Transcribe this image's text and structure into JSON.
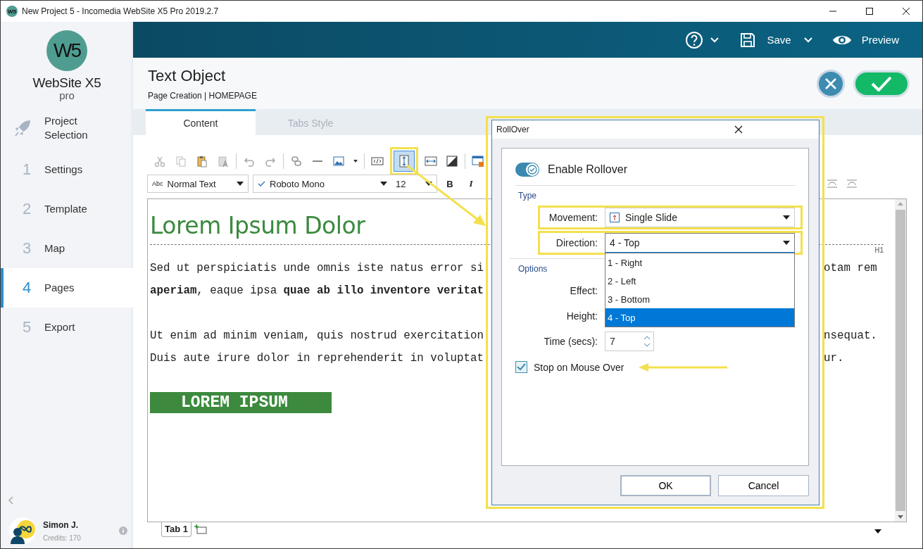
{
  "window": {
    "app_icon": "W5",
    "title": "New Project 5 - Incomedia WebSite X5 Pro 2019.2.7"
  },
  "sidebar": {
    "logo": {
      "mark": "W5",
      "name": "WebSite X5",
      "edition": "pro"
    },
    "items": [
      {
        "kind": "icon",
        "label": "Project Selection",
        "selected": false
      },
      {
        "kind": "numbered",
        "number": "1",
        "label": "Settings",
        "selected": false
      },
      {
        "kind": "numbered",
        "number": "2",
        "label": "Template",
        "selected": false
      },
      {
        "kind": "numbered",
        "number": "3",
        "label": "Map",
        "selected": false
      },
      {
        "kind": "numbered",
        "number": "4",
        "label": "Pages",
        "selected": true
      },
      {
        "kind": "numbered",
        "number": "5",
        "label": "Export",
        "selected": false
      }
    ],
    "user": {
      "name": "Simon J.",
      "credits": "Credits: 170"
    }
  },
  "topbar": {
    "save": "Save",
    "preview": "Preview"
  },
  "header": {
    "title": "Text Object",
    "breadcrumb": "Page Creation | HOMEPAGE"
  },
  "tabs": [
    {
      "label": "Content",
      "selected": true
    },
    {
      "label": "Tabs Style",
      "selected": false
    }
  ],
  "toolbar": [
    {
      "kind": "cut",
      "selected": false,
      "annotated": false
    },
    {
      "kind": "copy",
      "selected": false,
      "annotated": false
    },
    {
      "kind": "paste",
      "selected": false,
      "annotated": false
    },
    {
      "kind": "paste-text",
      "selected": false,
      "annotated": false
    },
    {
      "kind": "separator"
    },
    {
      "kind": "undo",
      "selected": false,
      "annotated": false
    },
    {
      "kind": "redo",
      "selected": false,
      "annotated": false
    },
    {
      "kind": "separator"
    },
    {
      "kind": "link",
      "selected": false,
      "annotated": false
    },
    {
      "kind": "rule",
      "selected": false,
      "annotated": false
    },
    {
      "kind": "image",
      "selected": false,
      "annotated": false
    },
    {
      "kind": "caret",
      "selected": false,
      "annotated": false
    },
    {
      "kind": "separator"
    },
    {
      "kind": "html",
      "selected": false,
      "annotated": false
    },
    {
      "kind": "rollover",
      "selected": true,
      "annotated": true
    },
    {
      "kind": "marquee",
      "selected": false,
      "annotated": false
    },
    {
      "kind": "contrast",
      "selected": false,
      "annotated": false
    },
    {
      "kind": "separator"
    },
    {
      "kind": "window",
      "selected": false,
      "annotated": false
    }
  ],
  "format_bar": {
    "style_prefix": "Abc",
    "style": "Normal Text",
    "font": "Roboto Mono",
    "size": "12",
    "bold": "B",
    "italic": "I"
  },
  "editor": {
    "heading": "Lorem Ipsum Dolor",
    "heading_tag": "H1",
    "paragraphs": [
      {
        "lines": [
          {
            "left": "Sed ut perspiciatis unde omnis iste natus error si",
            "right": "otam rem"
          },
          {
            "left": "**aperiam**, eaque ipsa **quae ab illo inventore veritat**"
          }
        ]
      },
      {
        "lines": [
          {
            "left": "Ut enim ad minim veniam, quis nostrud exercitation",
            "right": "nsequat."
          },
          {
            "left": "Duis aute irure dolor in reprehenderit in voluptat",
            "right": "ur."
          }
        ]
      }
    ],
    "button": "LOREM IPSUM",
    "tabs": [
      {
        "label": "Tab 1",
        "selected": true
      }
    ]
  },
  "dialog": {
    "title": "RollOver",
    "annotated": true,
    "enable": {
      "label": "Enable Rollover",
      "on": true
    },
    "type_label": "Type",
    "movement": {
      "label": "Movement:",
      "value": "Single Slide",
      "annotated": true
    },
    "direction": {
      "label": "Direction:",
      "value": "4 - Top",
      "annotated": true,
      "expanded": true,
      "options": [
        {
          "label": "1 - Right",
          "selected": false
        },
        {
          "label": "2 - Left",
          "selected": false
        },
        {
          "label": "3 - Bottom",
          "selected": false
        },
        {
          "label": "4 - Top",
          "selected": true
        }
      ]
    },
    "options_label": "Options",
    "effect": {
      "label": "Effect:"
    },
    "height": {
      "label": "Height:"
    },
    "time": {
      "label": "Time (secs):",
      "value": "7"
    },
    "stop": {
      "label": "Stop on Mouse Over",
      "checked": true,
      "annotated": true
    },
    "buttons": [
      "OK",
      "Cancel"
    ]
  }
}
